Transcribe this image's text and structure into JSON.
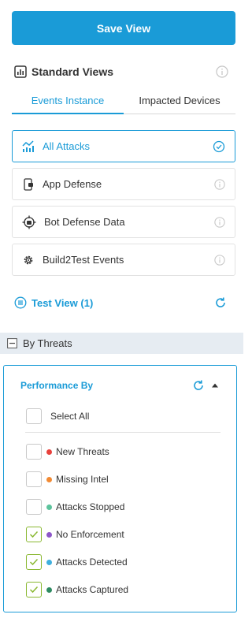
{
  "save_button": {
    "label": "Save View"
  },
  "standard_views": {
    "title": "Standard Views",
    "tabs": [
      {
        "label": "Events Instance",
        "active": true
      },
      {
        "label": "Impacted Devices",
        "active": false
      }
    ],
    "items": [
      {
        "label": "All Attacks",
        "icon": "trend-chart-icon",
        "selected": true
      },
      {
        "label": "App Defense",
        "icon": "mobile-app-icon",
        "selected": false
      },
      {
        "label": "Bot Defense Data",
        "icon": "bot-target-icon",
        "selected": false
      },
      {
        "label": "Build2Test Events",
        "icon": "gear-icon",
        "selected": false
      }
    ]
  },
  "test_view": {
    "label": "Test View (1)"
  },
  "by_threats": {
    "label": "By Threats"
  },
  "performance": {
    "title": "Performance By",
    "select_all": "Select All",
    "threats": [
      {
        "label": "New Threats",
        "color": "#e8413c",
        "checked": false
      },
      {
        "label": "Missing Intel",
        "color": "#f28a33",
        "checked": false
      },
      {
        "label": "Attacks Stopped",
        "color": "#5cc39c",
        "checked": false
      },
      {
        "label": "No Enforcement",
        "color": "#8e57c9",
        "checked": true
      },
      {
        "label": "Attacks Detected",
        "color": "#3fb0de",
        "checked": true
      },
      {
        "label": "Attacks Captured",
        "color": "#2e8b62",
        "checked": true
      }
    ]
  },
  "colors": {
    "accent": "#1a9bd7",
    "check": "#8ab832",
    "section_bg": "#e6ecf2"
  }
}
